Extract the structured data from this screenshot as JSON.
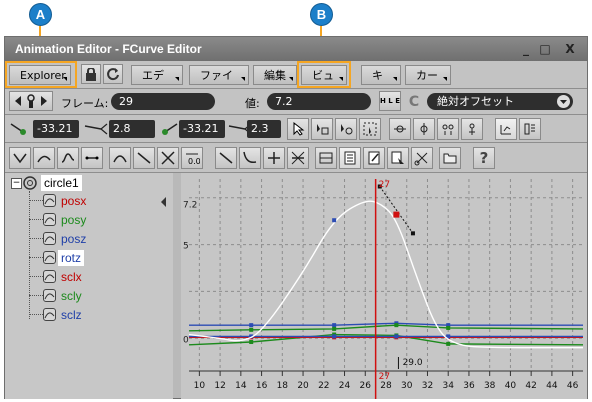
{
  "callouts": {
    "a": "A",
    "b": "B"
  },
  "window": {
    "title": "Animation Editor - FCurve Editor",
    "minimize": "_",
    "maximize": "□",
    "close": "X"
  },
  "menubar": {
    "explorer": "Explorer",
    "edit": "エディタ",
    "file": "ファイル",
    "henshu": "編集",
    "view": "ビュー",
    "key": "キー",
    "curve": "カーブ"
  },
  "keybar": {
    "frame_label": "フレーム:",
    "frame_value": "29",
    "value_label": "値:",
    "value_value": "7.2",
    "mode_value": "絶対オフセット",
    "mode_icon_letters": "H L E",
    "mode_icon_c": "C"
  },
  "tangents": {
    "left_a": "-33.21",
    "left_b": "2.8",
    "right_a": "-33.21",
    "right_b": "2.3"
  },
  "explorer": {
    "root": "circle1",
    "items": [
      {
        "label": "posx",
        "color": "#c00000"
      },
      {
        "label": "posy",
        "color": "#1c8a1c"
      },
      {
        "label": "posz",
        "color": "#1f3fa8"
      },
      {
        "label": "rotz",
        "color": "#1f3fa8"
      },
      {
        "label": "sclx",
        "color": "#c00000"
      },
      {
        "label": "scly",
        "color": "#1c8a1c"
      },
      {
        "label": "sclz",
        "color": "#1f3fa8"
      }
    ]
  },
  "graph": {
    "y_labels": [
      "7.2",
      "5",
      "0"
    ],
    "current_frame_top": "27",
    "current_frame_bottom": "27",
    "key_readout": "29.0",
    "x_ticks": [
      "10",
      "12",
      "14",
      "16",
      "18",
      "20",
      "22",
      "24",
      "26",
      "28",
      "30",
      "32",
      "34",
      "36",
      "38",
      "40",
      "42",
      "44",
      "46"
    ]
  },
  "colors": {
    "accent": "#f5a623",
    "callout": "#1c7fc9",
    "red_curve": "#d01010",
    "green_curve": "#1c8a1c",
    "blue_curve": "#2c4cb4"
  }
}
